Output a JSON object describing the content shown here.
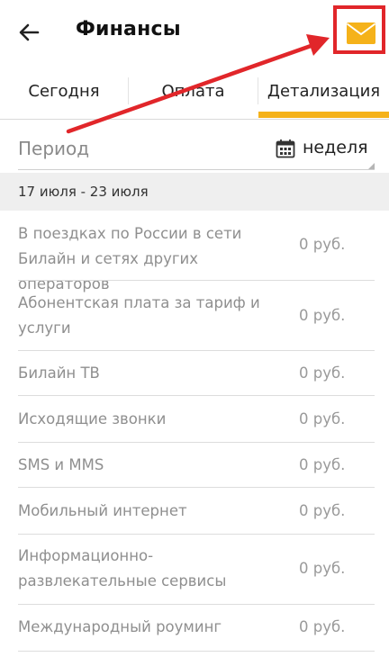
{
  "header": {
    "title": "Финансы"
  },
  "tabs": [
    {
      "label": "Сегодня",
      "active": false
    },
    {
      "label": "Оплата",
      "active": false
    },
    {
      "label": "Детализация",
      "active": true
    }
  ],
  "period": {
    "label": "Период",
    "value": "неделя"
  },
  "date_range": "17 июля - 23 июля",
  "rows": [
    {
      "label": "В поездках по России в сети Билайн и сетях других операторов",
      "amount": "0 руб."
    },
    {
      "label": "Абонентская плата за тариф и услуги",
      "amount": "0 руб."
    },
    {
      "label": "Билайн ТВ",
      "amount": "0 руб."
    },
    {
      "label": "Исходящие звонки",
      "amount": "0 руб."
    },
    {
      "label": "SMS и MMS",
      "amount": "0 руб."
    },
    {
      "label": "Мобильный интернет",
      "amount": "0 руб."
    },
    {
      "label": "Информационно-развлекательные сервисы",
      "amount": "0 руб."
    },
    {
      "label": "Международный роуминг",
      "amount": "0 руб."
    }
  ],
  "icons": {
    "back": "arrow-left-icon",
    "mail": "envelope-icon",
    "calendar": "calendar-icon"
  },
  "colors": {
    "accent": "#f5b21a",
    "highlight": "#e1262a",
    "band": "#efefef"
  }
}
